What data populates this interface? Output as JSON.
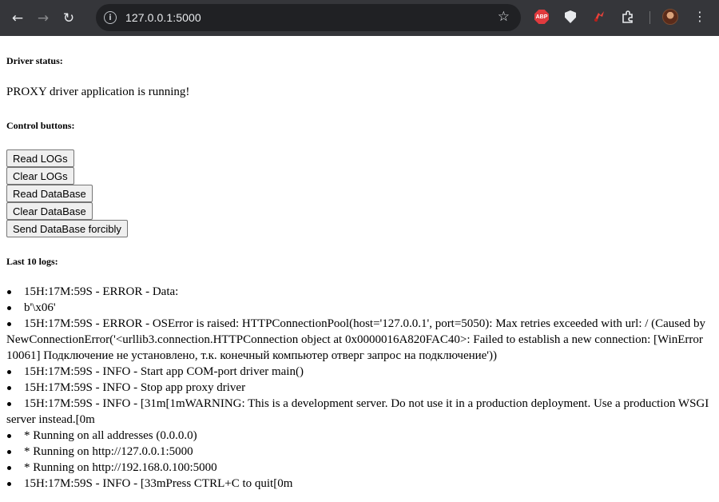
{
  "browser": {
    "url": "127.0.0.1:5000",
    "icons": {
      "back": "arrow-left-icon",
      "forward": "arrow-right-icon",
      "reload": "reload-icon",
      "info": "info-icon",
      "bookmark": "star-icon",
      "adblock": "abp-icon",
      "shield": "shield-icon",
      "extension_red": "red-extension-icon",
      "extensions": "puzzle-icon",
      "menu": "more-vert-icon"
    },
    "abp_label": "ABP"
  },
  "page": {
    "driver_status_heading": "Driver status:",
    "status_text": "PROXY driver application is running!",
    "control_heading": "Control buttons:",
    "buttons": [
      {
        "label": "Read LOGs"
      },
      {
        "label": "Clear LOGs"
      },
      {
        "label": "Read DataBase"
      },
      {
        "label": "Clear DataBase"
      },
      {
        "label": "Send DataBase forcibly"
      }
    ],
    "logs_heading": "Last 10 logs:",
    "logs": [
      "15H:17M:59S - ERROR - Data:",
      "b'\\x06'",
      "15H:17M:59S - ERROR - OSError is raised: HTTPConnectionPool(host='127.0.0.1', port=5050): Max retries exceeded with url: / (Caused by NewConnectionError('<urllib3.connection.HTTPConnection object at 0x0000016A820FAC40>: Failed to establish a new connection: [WinError 10061] Подключение не установлено, т.к. конечный компьютер отверг запрос на подключение'))",
      "15H:17M:59S - INFO - Start app COM-port driver main()",
      "15H:17M:59S - INFO - Stop app proxy driver",
      "15H:17M:59S - INFO - \u001b[31m\u001b[1mWARNING: This is a development server. Do not use it in a production deployment. Use a production WSGI server instead.\u001b[0m",
      "* Running on all addresses (0.0.0.0)",
      "* Running on http://127.0.0.1:5000",
      "* Running on http://192.168.0.100:5000",
      "15H:17M:59S - INFO - \u001b[33mPress CTRL+C to quit\u001b[0m"
    ]
  }
}
